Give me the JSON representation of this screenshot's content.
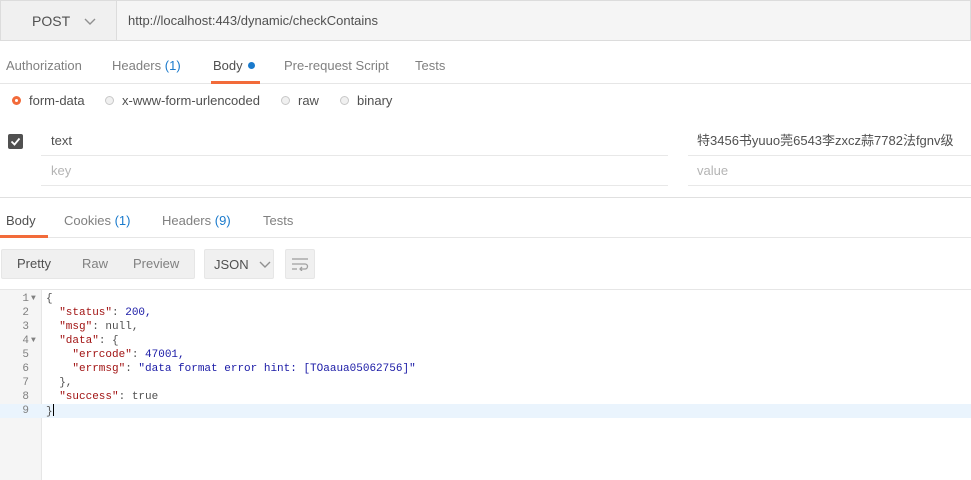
{
  "request": {
    "method": "POST",
    "url": "http://localhost:443/dynamic/checkContains",
    "tabs": [
      {
        "label": "Authorization"
      },
      {
        "label": "Headers",
        "count": "(1)"
      },
      {
        "label": "Body"
      },
      {
        "label": "Pre-request Script"
      },
      {
        "label": "Tests"
      }
    ],
    "active_tab": "Body",
    "body_types": [
      "form-data",
      "x-www-form-urlencoded",
      "raw",
      "binary"
    ],
    "selected_body_type": "form-data",
    "form_rows": [
      {
        "checked": true,
        "key": "text",
        "value": "特3456书yuuo莞6543李zxcz蒜7782法fgnv级"
      }
    ],
    "key_placeholder": "key",
    "value_placeholder": "value"
  },
  "response": {
    "tabs": [
      {
        "label": "Body"
      },
      {
        "label": "Cookies",
        "count": "(1)"
      },
      {
        "label": "Headers",
        "count": "(9)"
      },
      {
        "label": "Tests"
      }
    ],
    "active_tab": "Body",
    "views": [
      "Pretty",
      "Raw",
      "Preview"
    ],
    "selected_view": "Pretty",
    "format": "JSON",
    "code_lines": [
      {
        "num": "1",
        "text": "{"
      },
      {
        "num": "2",
        "key": "\"status\"",
        "value": "200,"
      },
      {
        "num": "3",
        "key": "\"msg\"",
        "value": "null,"
      },
      {
        "num": "4",
        "key": "\"data\"",
        "value": "{"
      },
      {
        "num": "5",
        "key": "\"errcode\"",
        "value": "47001,"
      },
      {
        "num": "6",
        "key": "\"errmsg\"",
        "value": "\"data format error hint: [TOaaua05062756]\""
      },
      {
        "num": "7",
        "text": "},"
      },
      {
        "num": "8",
        "key": "\"success\"",
        "value": "true"
      },
      {
        "num": "9",
        "text": "}"
      }
    ]
  },
  "colors": {
    "accent": "#f26b3a",
    "link_blue": "#1a7acc",
    "key_red": "#a11313",
    "value_blue": "#1a1aa6"
  },
  "icons": {
    "method_dropdown": "chevron-down-icon",
    "format_dropdown": "chevron-down-icon",
    "wrap": "wrap-lines-icon",
    "checkbox": "checkmark-icon"
  }
}
